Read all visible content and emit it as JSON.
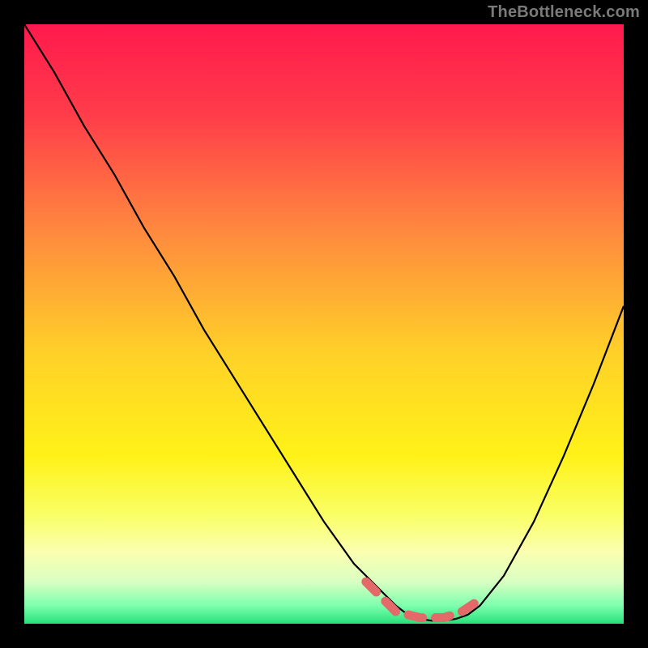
{
  "attribution": "TheBottleneck.com",
  "chart_data": {
    "type": "line",
    "title": "",
    "xlabel": "",
    "ylabel": "",
    "xlim": [
      0,
      100
    ],
    "ylim": [
      0,
      100
    ],
    "x": [
      0,
      5,
      10,
      15,
      20,
      25,
      30,
      35,
      40,
      45,
      50,
      55,
      60,
      62,
      64,
      66,
      68,
      70,
      72,
      74,
      76,
      80,
      85,
      90,
      95,
      100
    ],
    "values": [
      100,
      92,
      83,
      75,
      66,
      58,
      49,
      41,
      33,
      25,
      17,
      10,
      5,
      3,
      1.5,
      0.8,
      0.5,
      0.5,
      0.8,
      1.5,
      3,
      8,
      17,
      28,
      40,
      53
    ],
    "optimum_segments_x": [
      57,
      60,
      62,
      66,
      70,
      73,
      76
    ],
    "optimum_segments_y": [
      7,
      4,
      2,
      1,
      1,
      2,
      4
    ],
    "background": {
      "type": "vertical-gradient",
      "stops": [
        {
          "pos": 0.0,
          "color": "#ff1a4d"
        },
        {
          "pos": 0.15,
          "color": "#ff3c4a"
        },
        {
          "pos": 0.35,
          "color": "#ff8b3e"
        },
        {
          "pos": 0.55,
          "color": "#ffd128"
        },
        {
          "pos": 0.72,
          "color": "#fff218"
        },
        {
          "pos": 0.82,
          "color": "#f9ff67"
        },
        {
          "pos": 0.88,
          "color": "#fbffb0"
        },
        {
          "pos": 0.93,
          "color": "#d9ffc2"
        },
        {
          "pos": 0.97,
          "color": "#7dffad"
        },
        {
          "pos": 1.0,
          "color": "#27e07a"
        }
      ]
    },
    "curve_color": "#000000",
    "marker_color": "#e46a6a"
  }
}
